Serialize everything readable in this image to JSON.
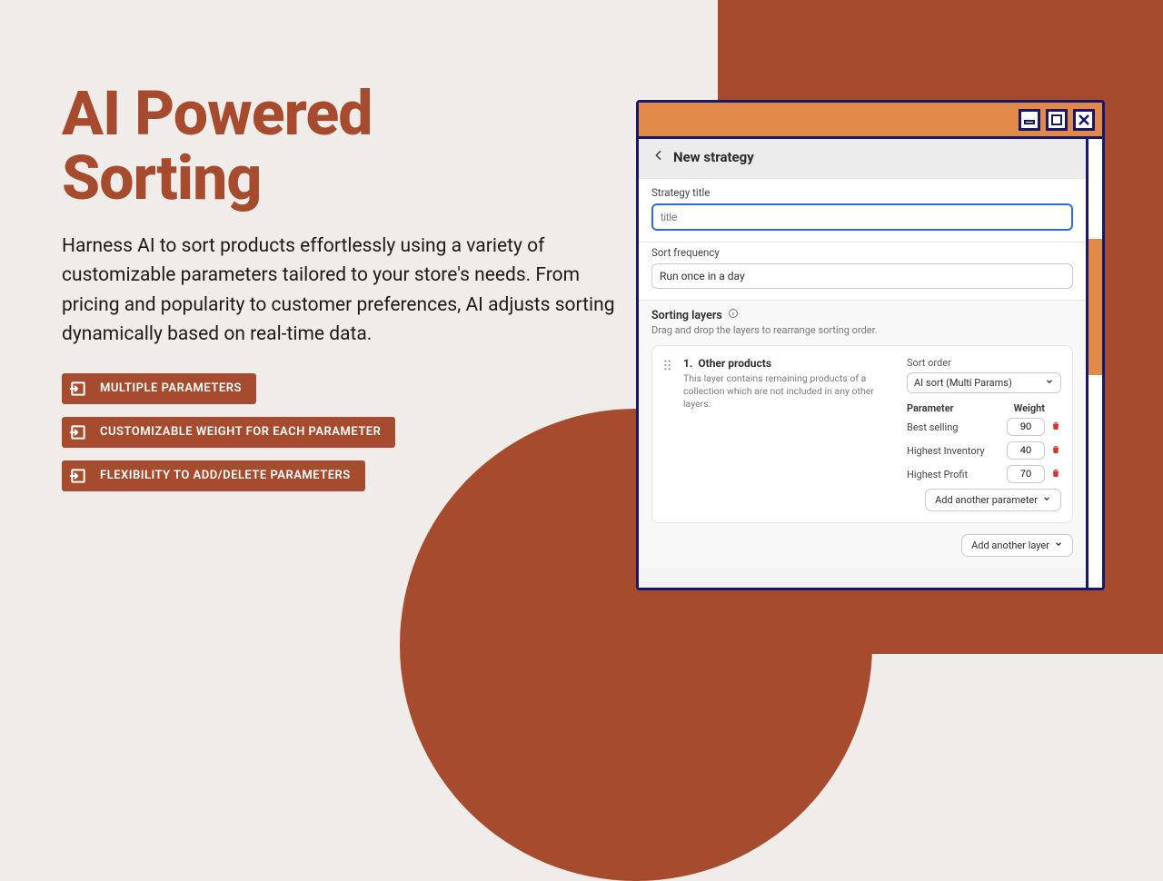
{
  "hero": {
    "title_line1": "AI Powered",
    "title_line2": "Sorting",
    "description": "Harness AI to sort products effortlessly using a variety of customizable parameters tailored to your store's needs. From pricing and popularity to customer preferences, AI adjusts sorting dynamically based on real-time data."
  },
  "pills": [
    {
      "label": "MULTIPLE PARAMETERS"
    },
    {
      "label": "CUSTOMIZABLE WEIGHT FOR EACH PARAMETER"
    },
    {
      "label": "FLEXIBILITY TO ADD/DELETE PARAMETERS"
    }
  ],
  "app": {
    "page_title": "New strategy",
    "strategy_title_label": "Strategy title",
    "strategy_title_placeholder": "title",
    "sort_frequency_label": "Sort frequency",
    "sort_frequency_value": "Run once in a day",
    "sorting_layers_label": "Sorting layers",
    "sorting_layers_help": "Drag and drop the layers to rearrange sorting order.",
    "layer": {
      "index": "1.",
      "name": "Other products",
      "description": "This layer contains remaining products of a collection which are not included in any other layers.",
      "sort_order_label": "Sort order",
      "sort_order_value": "AI sort (Multi Params)",
      "col_parameter": "Parameter",
      "col_weight": "Weight",
      "params": [
        {
          "name": "Best selling",
          "weight": "90"
        },
        {
          "name": "Highest Inventory",
          "weight": "40"
        },
        {
          "name": "Highest Profit",
          "weight": "70"
        }
      ],
      "add_param_label": "Add another parameter"
    },
    "add_layer_label": "Add another layer"
  }
}
